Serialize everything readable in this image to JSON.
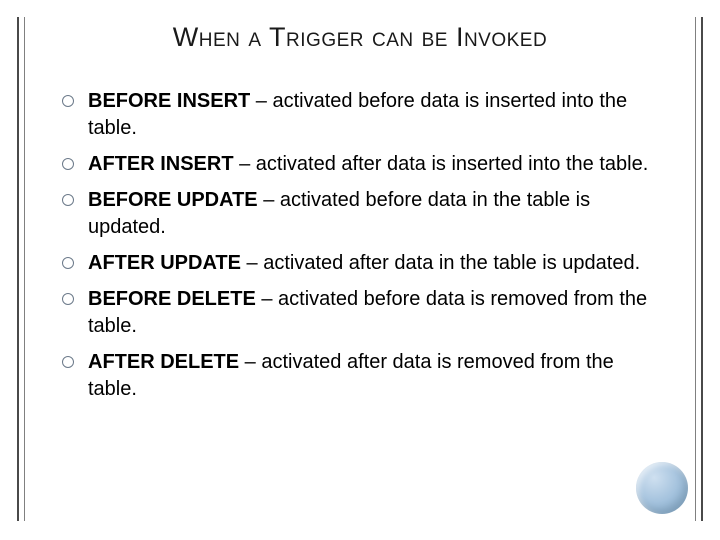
{
  "title": "When a Trigger can be Invoked",
  "items": [
    {
      "term": "BEFORE INSERT",
      "desc": " – activated before data is inserted into the table."
    },
    {
      "term": "AFTER INSERT",
      "desc": " – activated after data is inserted into the table."
    },
    {
      "term": "BEFORE UPDATE",
      "desc": " – activated before data in the table is updated."
    },
    {
      "term": "AFTER UPDATE",
      "desc": " – activated after data in the table is updated."
    },
    {
      "term": "BEFORE DELETE",
      "desc": " – activated before data is removed from the table."
    },
    {
      "term": "AFTER DELETE",
      "desc": " – activated after data is removed from the table."
    }
  ]
}
